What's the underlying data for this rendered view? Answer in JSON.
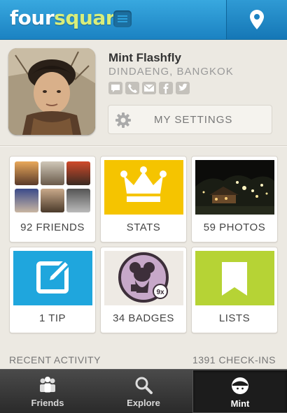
{
  "header": {
    "logo_part1": "four",
    "logo_part2": "square",
    "menu_icon": "menu-icon",
    "location_icon": "location-pin-icon",
    "brand_color": "#1b82c2"
  },
  "profile": {
    "name": "Mint Flashfly",
    "location": "DINDAENG, BANGKOK",
    "contact_icons": [
      "comment-icon",
      "phone-icon",
      "email-icon",
      "facebook-icon",
      "twitter-icon"
    ],
    "settings_label": "MY SETTINGS"
  },
  "tiles": [
    {
      "label": "92 FRIENDS",
      "icon": "friends-collage"
    },
    {
      "label": "STATS",
      "icon": "crown-icon",
      "color": "#f5c400"
    },
    {
      "label": "59 PHOTOS",
      "icon": "photo-thumbnail"
    },
    {
      "label": "1 TIP",
      "icon": "edit-icon",
      "color": "#1fa6dd"
    },
    {
      "label": "34 BADGES",
      "icon": "badge-icon",
      "badge_count": "9x"
    },
    {
      "label": "LISTS",
      "icon": "bookmark-icon",
      "color": "#b6d335"
    }
  ],
  "activity": {
    "recent_label": "RECENT ACTIVITY",
    "checkins_label": "1391 CHECK-INS"
  },
  "nav": {
    "items": [
      {
        "label": "Friends",
        "icon": "friends-icon"
      },
      {
        "label": "Explore",
        "icon": "search-icon"
      },
      {
        "label": "Mint",
        "icon": "profile-icon"
      }
    ],
    "active": "Mint"
  }
}
